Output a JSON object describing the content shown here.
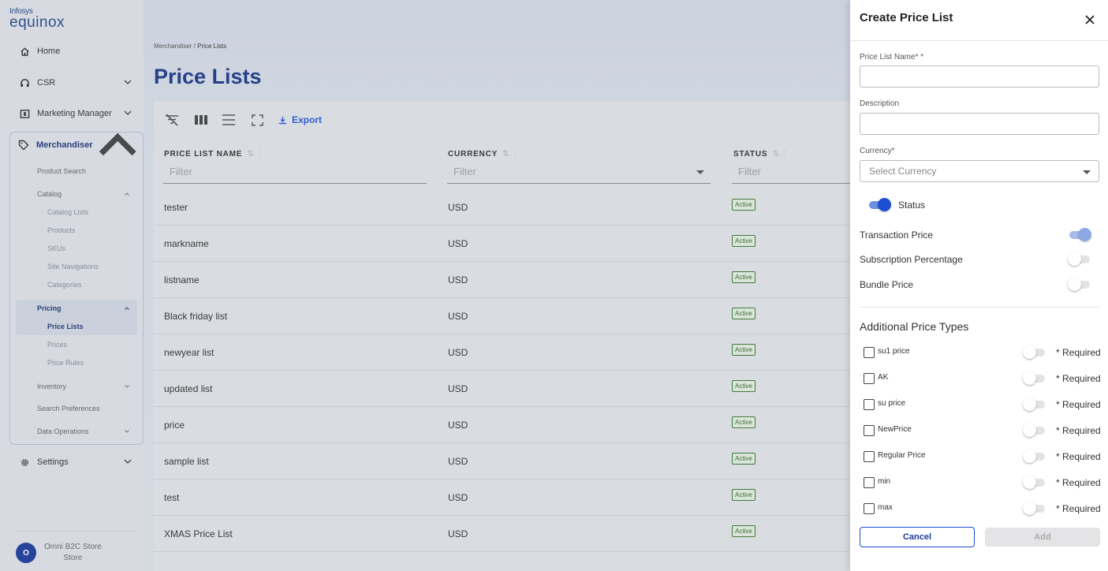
{
  "logo": {
    "line1": "Infosys",
    "line2": "equinox"
  },
  "sidebar": {
    "home": "Home",
    "csr": "CSR",
    "marketing": "Marketing Manager",
    "merchandiser": "Merchandiser",
    "product_search": "Product Search",
    "catalog": "Catalog",
    "catalog_items": [
      "Catalog Lists",
      "Products",
      "SKUs",
      "Site Navigations",
      "Categories"
    ],
    "pricing": "Pricing",
    "pricing_items": [
      "Price Lists",
      "Prices",
      "Price Rules"
    ],
    "inventory": "Inventory",
    "search_preferences": "Search Preferences",
    "data_operations": "Data Operations",
    "settings": "Settings",
    "store_avatar": "O",
    "store_name": "Omni B2C Store",
    "store_type": "Store"
  },
  "breadcrumb": {
    "parent": "Merchandiser",
    "sep": "/",
    "current": "Price Lists"
  },
  "page_title": "Price Lists",
  "toolbar": {
    "export_label": "Export"
  },
  "columns": [
    {
      "label": "PRICE LIST NAME",
      "filter_placeholder": "Filter"
    },
    {
      "label": "CURRENCY",
      "filter_placeholder": "Filter"
    },
    {
      "label": "STATUS",
      "filter_placeholder": "Filter"
    }
  ],
  "rows": [
    {
      "name": "tester",
      "currency": "USD",
      "status": "Active"
    },
    {
      "name": "markname",
      "currency": "USD",
      "status": "Active"
    },
    {
      "name": "listname",
      "currency": "USD",
      "status": "Active"
    },
    {
      "name": "Black friday list",
      "currency": "USD",
      "status": "Active"
    },
    {
      "name": "newyear list",
      "currency": "USD",
      "status": "Active"
    },
    {
      "name": "updated list",
      "currency": "USD",
      "status": "Active"
    },
    {
      "name": "price",
      "currency": "USD",
      "status": "Active"
    },
    {
      "name": "sample list",
      "currency": "USD",
      "status": "Active"
    },
    {
      "name": "test",
      "currency": "USD",
      "status": "Active"
    },
    {
      "name": "XMAS Price List",
      "currency": "USD",
      "status": "Active"
    }
  ],
  "drawer": {
    "title": "Create Price List",
    "name_label": "Price List Name* *",
    "name_value": "",
    "description_label": "Description",
    "description_value": "",
    "currency_label": "Currency*",
    "currency_placeholder": "Select Currency",
    "status_label": "Status",
    "status_on": true,
    "transaction_price_label": "Transaction Price",
    "transaction_price_on": true,
    "subscription_label": "Subscription Percentage",
    "subscription_on": false,
    "bundle_label": "Bundle Price",
    "bundle_on": false,
    "additional_title": "Additional Price Types",
    "required_label": "* Required",
    "price_types": [
      {
        "name": "su1 price",
        "checked": false,
        "required": false
      },
      {
        "name": "AK",
        "checked": false,
        "required": false
      },
      {
        "name": "su price",
        "checked": false,
        "required": false
      },
      {
        "name": "NewPrice",
        "checked": false,
        "required": false
      },
      {
        "name": "Regular Price",
        "checked": false,
        "required": false
      },
      {
        "name": "min",
        "checked": false,
        "required": false
      },
      {
        "name": "max",
        "checked": false,
        "required": false
      }
    ],
    "cancel_label": "Cancel",
    "add_label": "Add"
  },
  "colors": {
    "accent": "#1d4fd1",
    "title": "#1e3a8a",
    "active_badge": "#3c7a32"
  }
}
